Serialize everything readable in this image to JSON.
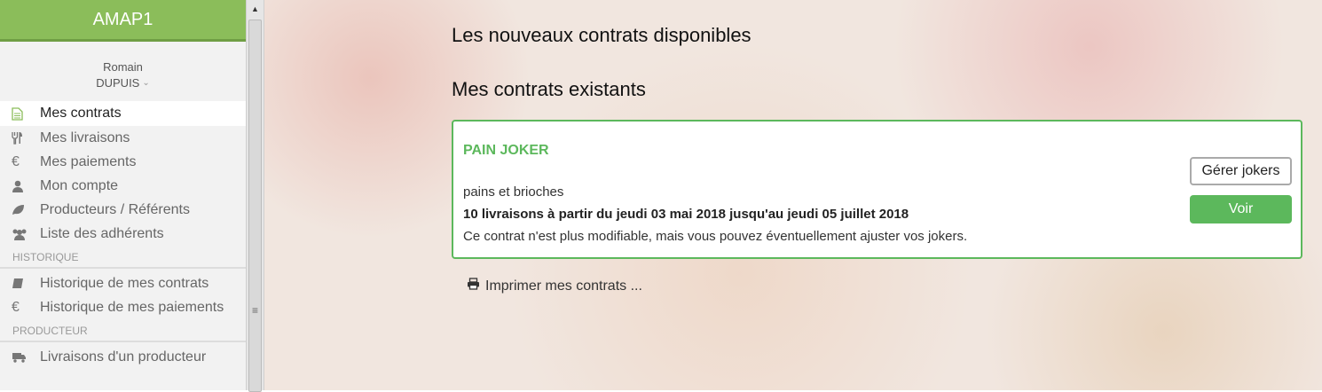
{
  "sidebar": {
    "brand": "AMAP1",
    "user": {
      "first_name": "Romain",
      "last_name": "DUPUIS"
    },
    "items": [
      {
        "label": "Mes contrats",
        "icon": "file-text-icon"
      },
      {
        "label": "Mes livraisons",
        "icon": "cutlery-icon"
      },
      {
        "label": "Mes paiements",
        "icon": "euro-icon"
      },
      {
        "label": "Mon compte",
        "icon": "user-icon"
      },
      {
        "label": "Producteurs / Référents",
        "icon": "leaf-icon"
      },
      {
        "label": "Liste des adhérents",
        "icon": "users-icon"
      }
    ],
    "section_historique": "HISTORIQUE",
    "historique_items": [
      {
        "label": "Historique de mes contrats",
        "icon": "book-icon"
      },
      {
        "label": "Historique de mes paiements",
        "icon": "euro-icon"
      }
    ],
    "section_producteur": "PRODUCTEUR",
    "producteur_items": [
      {
        "label": "Livraisons d'un producteur",
        "icon": "truck-icon"
      }
    ]
  },
  "main": {
    "new_contracts_title": "Les nouveaux contrats disponibles",
    "existing_contracts_title": "Mes contrats existants",
    "contract": {
      "title": "PAIN JOKER",
      "description": "pains et brioches",
      "dates": "10 livraisons à partir du jeudi 03 mai 2018 jusqu'au jeudi 05 juillet 2018",
      "note": "Ce contrat n'est plus modifiable, mais vous pouvez éventuellement ajuster vos jokers.",
      "jokers_button": "Gérer jokers",
      "view_button": "Voir"
    },
    "print_link": "Imprimer mes contrats ..."
  },
  "colors": {
    "brand": "#8bbd5a",
    "accent": "#5cb85c"
  }
}
